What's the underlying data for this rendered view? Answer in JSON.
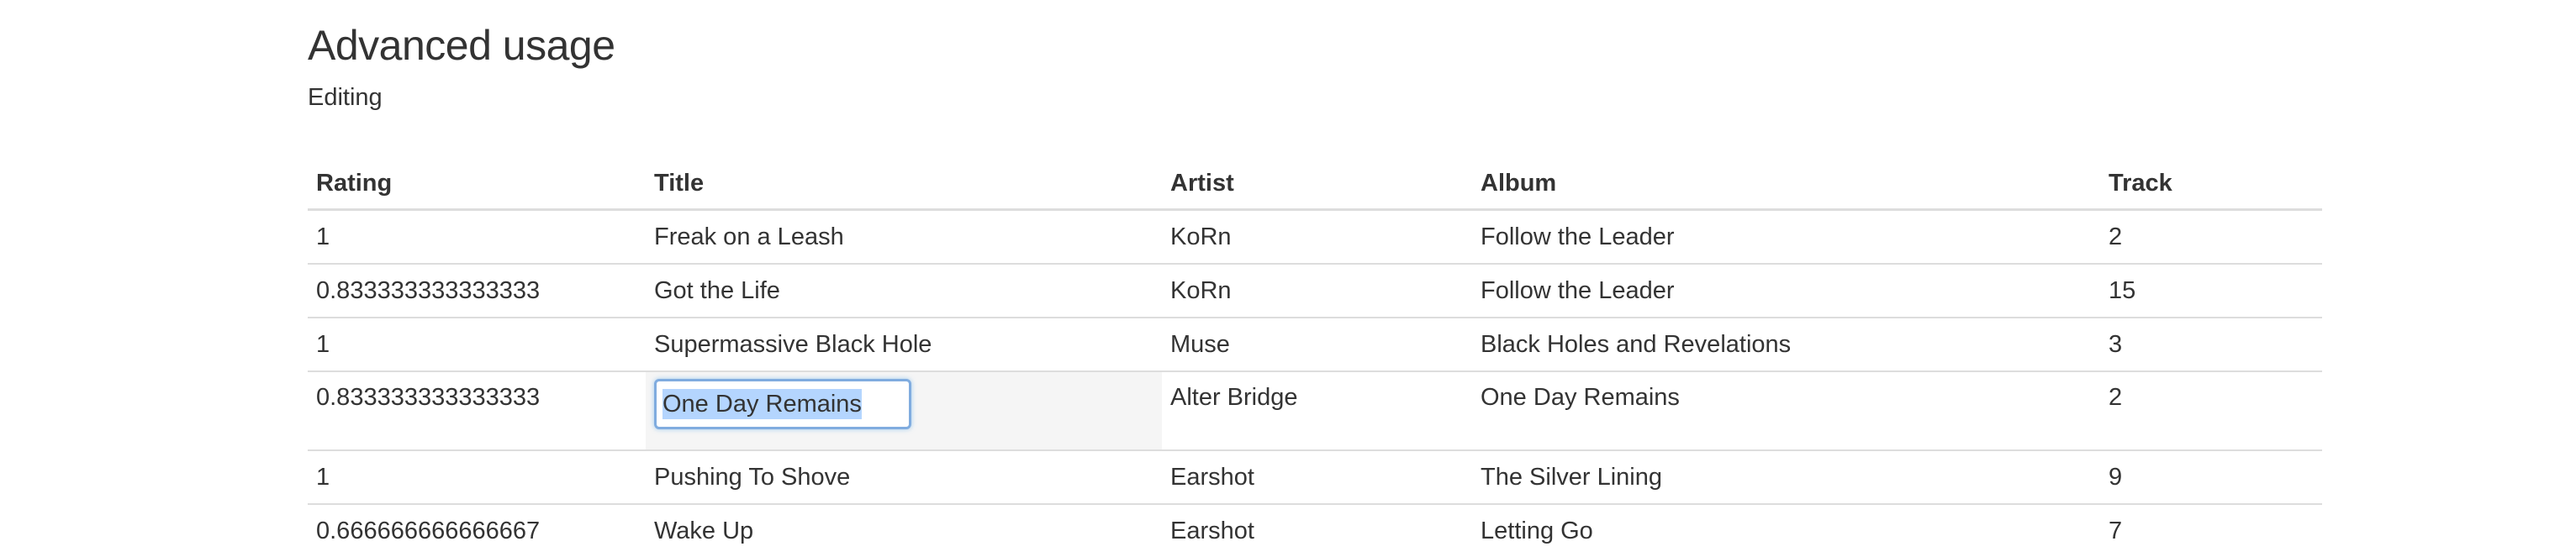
{
  "page": {
    "title": "Advanced usage",
    "subtitle": "Editing"
  },
  "table": {
    "columns": [
      "Rating",
      "Title",
      "Artist",
      "Album",
      "Track"
    ],
    "rows": [
      {
        "rating": "1",
        "title": "Freak on a Leash",
        "artist": "KoRn",
        "album": "Follow the Leader",
        "track": "2"
      },
      {
        "rating": "0.833333333333333",
        "title": "Got the Life",
        "artist": "KoRn",
        "album": "Follow the Leader",
        "track": "15"
      },
      {
        "rating": "1",
        "title": "Supermassive Black Hole",
        "artist": "Muse",
        "album": "Black Holes and Revelations",
        "track": "3"
      },
      {
        "rating": "0.833333333333333",
        "title": "One Day Remains",
        "artist": "Alter Bridge",
        "album": "One Day Remains",
        "track": "2"
      },
      {
        "rating": "1",
        "title": "Pushing To Shove",
        "artist": "Earshot",
        "album": "The Silver Lining",
        "track": "9"
      },
      {
        "rating": "0.666666666666667",
        "title": "Wake Up",
        "artist": "Earshot",
        "album": "Letting Go",
        "track": "7"
      }
    ],
    "editing": {
      "row_index": 3,
      "column": "title",
      "input_value": "One Day Remains"
    }
  },
  "colors": {
    "text": "#333333",
    "border": "#dddddd",
    "focus_border": "#80acdf",
    "selection": "#b4d5fe",
    "editing_cell_bg": "#f5f5f5"
  }
}
